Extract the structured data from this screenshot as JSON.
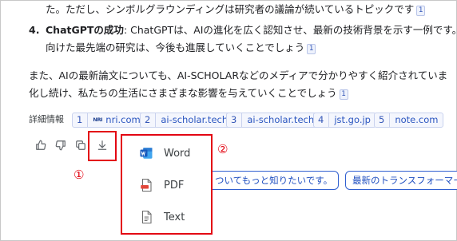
{
  "content": {
    "line1": "た。ただし、シンボルグラウンディングは研究者の議論が続いているトピックです",
    "line1_cite": "1",
    "item4_number": "4.",
    "item4_bold": "ChatGPTの成功",
    "item4_text": ": ChatGPTは、AIの進化を広く認知させ、最新の技術背景を示す一例です。",
    "item4_line2": "向けた最先端の研究は、今後も進展していくことでしょう",
    "item4_cite": "1",
    "para_line1": "また、AIの最新論文についても、AI-SCHOLARなどのメディアで分かりやすく紹介されていま",
    "para_line2": "化し続け、私たちの生活にさまざまな影響を与えていくことでしょう",
    "para_cite": "1"
  },
  "sources": {
    "label": "詳細情報",
    "items": [
      {
        "index": "1",
        "logo": "NRI",
        "site": "nri.com"
      },
      {
        "index": "2",
        "site": "ai-scholar.tech"
      },
      {
        "index": "3",
        "site": "ai-scholar.tech"
      },
      {
        "index": "4",
        "site": "jst.go.jp"
      },
      {
        "index": "5",
        "site": "note.com"
      }
    ]
  },
  "actions": {
    "icons": [
      "thumbs-up-icon",
      "thumbs-down-icon",
      "copy-icon",
      "download-icon"
    ]
  },
  "annotations": {
    "marker1": "①",
    "marker2": "②",
    "highlight_color": "#e30613"
  },
  "export_menu": {
    "items": [
      {
        "label": "Word",
        "icon": "word-icon"
      },
      {
        "label": "PDF",
        "icon": "pdf-icon"
      },
      {
        "label": "Text",
        "icon": "text-file-icon"
      }
    ]
  },
  "suggestions": {
    "chip1": "ついてもっと知りたいです。",
    "chip2": "最新のトランスフォーマー"
  }
}
